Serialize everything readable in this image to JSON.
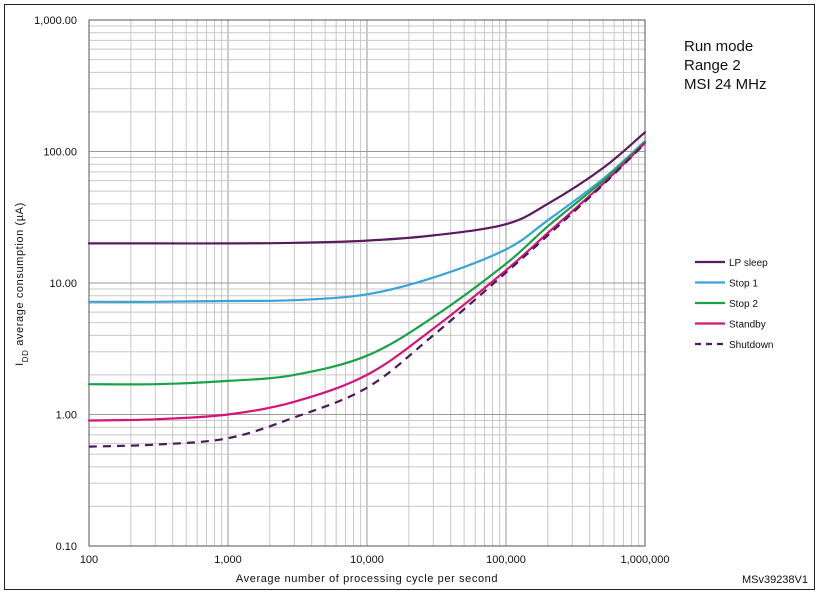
{
  "chart_data": {
    "type": "line",
    "title": "",
    "xlabel": "Average number of processing cycle per second",
    "ylabel": "IDD average consumption (µA)",
    "ylabel_main": "I",
    "ylabel_sub": "DD",
    "ylabel_rest": " average consumption (µA)",
    "x_scale": "log",
    "y_scale": "log",
    "xlim": [
      100,
      1000000
    ],
    "ylim": [
      0.1,
      1000
    ],
    "grid": true,
    "legend_position": "right",
    "x_ticks": [
      {
        "value": 100,
        "label": "100"
      },
      {
        "value": 1000,
        "label": "1,000"
      },
      {
        "value": 10000,
        "label": "10,000"
      },
      {
        "value": 100000,
        "label": "100,000"
      },
      {
        "value": 1000000,
        "label": "1,000,000"
      }
    ],
    "y_ticks": [
      {
        "value": 0.1,
        "label": "0.10"
      },
      {
        "value": 1,
        "label": "1.00"
      },
      {
        "value": 10,
        "label": "10.00"
      },
      {
        "value": 100,
        "label": "100.00"
      },
      {
        "value": 1000,
        "label": "1,000.00"
      }
    ],
    "annotations": [
      "Run mode",
      "Range 2",
      "MSI 24 MHz"
    ],
    "figure_id": "MSv39238V1",
    "series": [
      {
        "name": "LP sleep",
        "color": "#5a1a5e",
        "dash": false,
        "x": [
          100,
          300,
          1000,
          3000,
          10000,
          30000,
          100000,
          200000,
          500000,
          1000000
        ],
        "y": [
          20,
          20,
          20,
          20.2,
          21,
          23,
          28,
          40,
          75,
          140
        ]
      },
      {
        "name": "Stop 1",
        "color": "#3aa3d8",
        "dash": false,
        "x": [
          100,
          300,
          1000,
          3000,
          10000,
          30000,
          100000,
          200000,
          500000,
          1000000
        ],
        "y": [
          7.2,
          7.2,
          7.3,
          7.4,
          8.2,
          11,
          18,
          30,
          62,
          120
        ]
      },
      {
        "name": "Stop 2",
        "color": "#1aa24a",
        "dash": false,
        "x": [
          100,
          300,
          1000,
          3000,
          10000,
          30000,
          100000,
          200000,
          500000,
          1000000
        ],
        "y": [
          1.7,
          1.7,
          1.8,
          2.0,
          2.8,
          5.5,
          14,
          27,
          60,
          118
        ]
      },
      {
        "name": "Standby",
        "color": "#d6137a",
        "dash": false,
        "x": [
          100,
          300,
          1000,
          3000,
          10000,
          30000,
          100000,
          200000,
          500000,
          1000000
        ],
        "y": [
          0.9,
          0.92,
          1.0,
          1.25,
          2.0,
          4.5,
          12.5,
          24,
          57,
          116
        ]
      },
      {
        "name": "Shutdown",
        "color": "#4a1a5a",
        "dash": true,
        "x": [
          100,
          300,
          1000,
          3000,
          10000,
          30000,
          100000,
          200000,
          500000,
          1000000
        ],
        "y": [
          0.57,
          0.59,
          0.66,
          0.95,
          1.6,
          4.0,
          12,
          23,
          56,
          115
        ]
      }
    ]
  }
}
